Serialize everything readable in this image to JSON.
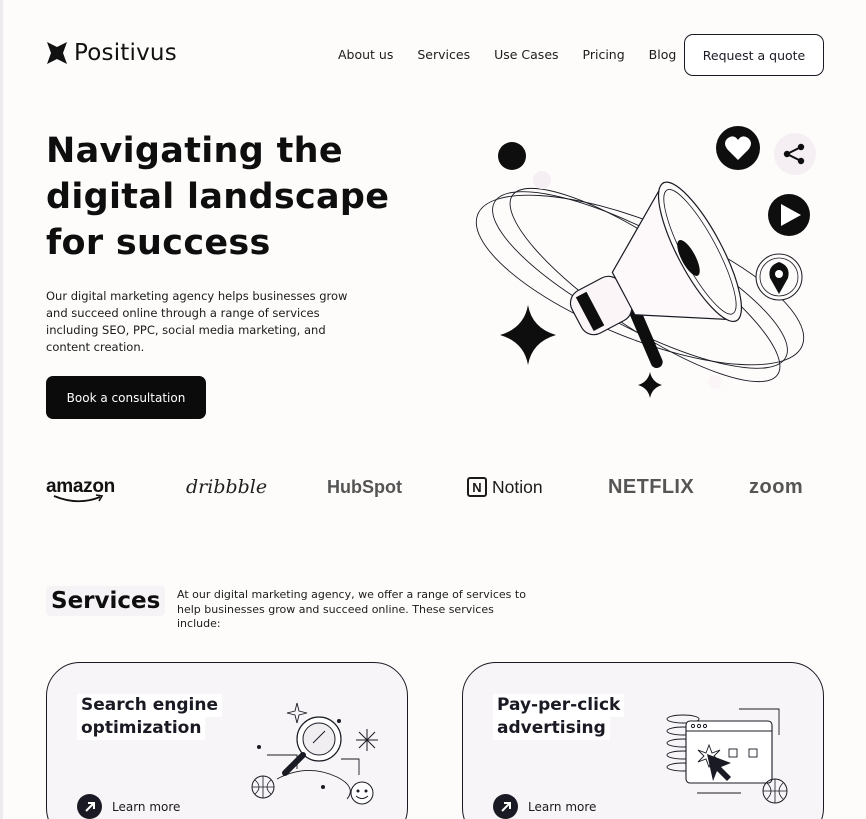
{
  "header": {
    "logo_text": "Positivus",
    "nav": [
      "About us",
      "Services",
      "Use Cases",
      "Pricing",
      "Blog"
    ],
    "cta_label": "Request a quote"
  },
  "hero": {
    "title": "Navigating the digital landscape for success",
    "description": "Our digital marketing agency helps businesses grow and succeed online through a range of services including SEO, PPC, social media marketing, and content creation.",
    "button_label": "Book a consultation"
  },
  "brands": {
    "amazon": "amazon",
    "dribbble": "dribbble",
    "hubspot": "HubSpot",
    "notion": "Notion",
    "notion_mark": "N",
    "netflix": "NETFLIX",
    "zoom": "zoom"
  },
  "services": {
    "heading": "Services",
    "description": "At our digital marketing agency, we offer a range of services to help businesses grow and succeed online. These services include:",
    "cards": [
      {
        "title_line1": "Search engine",
        "title_line2": "optimization",
        "link_label": "Learn more",
        "icon": "magnifier-illustration"
      },
      {
        "title_line1": "Pay-per-click",
        "title_line2": "advertising",
        "link_label": "Learn more",
        "icon": "click-browser-illustration"
      }
    ]
  },
  "colors": {
    "dark": "#191A23",
    "light": "#F3F3F3",
    "background": "#FDFCFB"
  }
}
